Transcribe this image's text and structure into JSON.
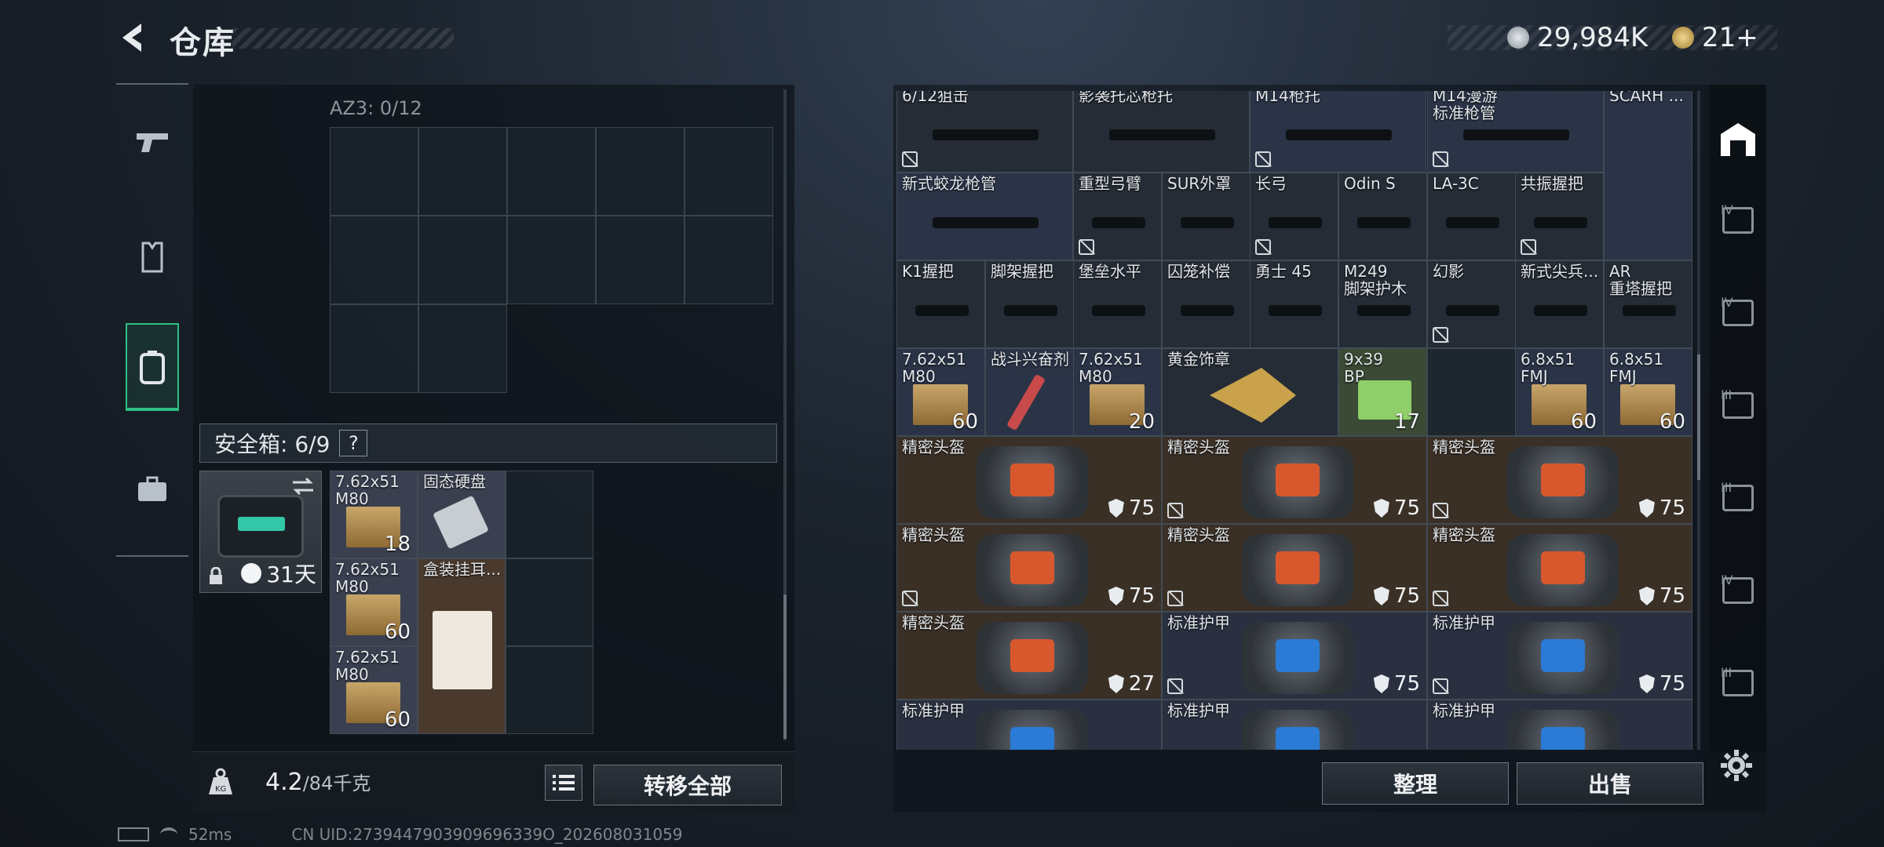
{
  "header": {
    "title": "仓库",
    "currency1": "29,984K",
    "currency2": "21+"
  },
  "left": {
    "az3_label": "AZ3: 0/12",
    "safe_label": "安全箱: 6/9",
    "safe_help": "?",
    "safe_days": "31天",
    "safe_items": [
      {
        "name": "7.62x51\nM80",
        "count": "18"
      },
      {
        "name": "固态硬盘",
        "count": ""
      },
      {
        "name": "7.62x51\nM80",
        "count": "60"
      },
      {
        "name": "盒装挂耳...",
        "count": ""
      },
      {
        "name": "7.62x51\nM80",
        "count": "60"
      }
    ],
    "weight_value": "4.2",
    "weight_max": "/84千克",
    "transfer_all": "转移全部"
  },
  "right": {
    "row1": [
      "6/12狙击",
      "影袭托芯枪托",
      "M14枪托",
      "M14漫游\n标准枪管",
      "SCARH ..."
    ],
    "row2": [
      "新式蛟龙枪管",
      "重型弓臂",
      "SUR外罩",
      "长弓",
      "Odin S",
      "LA-3C",
      "共振握把"
    ],
    "row3": [
      "K1握把",
      "脚架握把",
      "堡垒水平",
      "囚笼补偿",
      "勇士 45",
      "M249\n脚架护木",
      "幻影",
      "新式尖兵...",
      "AR\n重塔握把"
    ],
    "row4": [
      {
        "name": "7.62x51\nM80",
        "count": "60"
      },
      {
        "name": "战斗兴奋剂",
        "count": ""
      },
      {
        "name": "7.62x51\nM80",
        "count": "20"
      },
      {
        "name": "黄金饰章",
        "count": ""
      },
      {
        "name": "9x39\nBP",
        "count": "17"
      },
      {
        "name": "6.8x51\nFMJ",
        "count": "60"
      },
      {
        "name": "6.8x51\nFMJ",
        "count": "60"
      }
    ],
    "gear": [
      {
        "name": "精密头盔",
        "durability": "75"
      },
      {
        "name": "精密头盔",
        "durability": "75"
      },
      {
        "name": "精密头盔",
        "durability": "75"
      },
      {
        "name": "精密头盔",
        "durability": "75"
      },
      {
        "name": "精密头盔",
        "durability": "75"
      },
      {
        "name": "精密头盔",
        "durability": "75"
      },
      {
        "name": "精密头盔",
        "durability": "27"
      },
      {
        "name": "标准护甲",
        "durability": "75"
      },
      {
        "name": "标准护甲",
        "durability": "75"
      },
      {
        "name": "标准护甲",
        "durability": ""
      },
      {
        "name": "标准护甲",
        "durability": ""
      },
      {
        "name": "标准护甲",
        "durability": ""
      }
    ],
    "sort_button": "整理",
    "sell_button": "出售",
    "tabs": [
      "IV",
      "IV",
      "III",
      "III",
      "IV",
      "III"
    ]
  },
  "status": {
    "ping": "52ms",
    "uid": "CN UID:2739447903909696339O_202608031059"
  },
  "colors": {
    "accent": "#2fbf83",
    "gold": "#c9a24b",
    "helmet_bg": "#3a3028",
    "armor_bg": "#2a3040",
    "weapon_bg": "#252c36"
  }
}
